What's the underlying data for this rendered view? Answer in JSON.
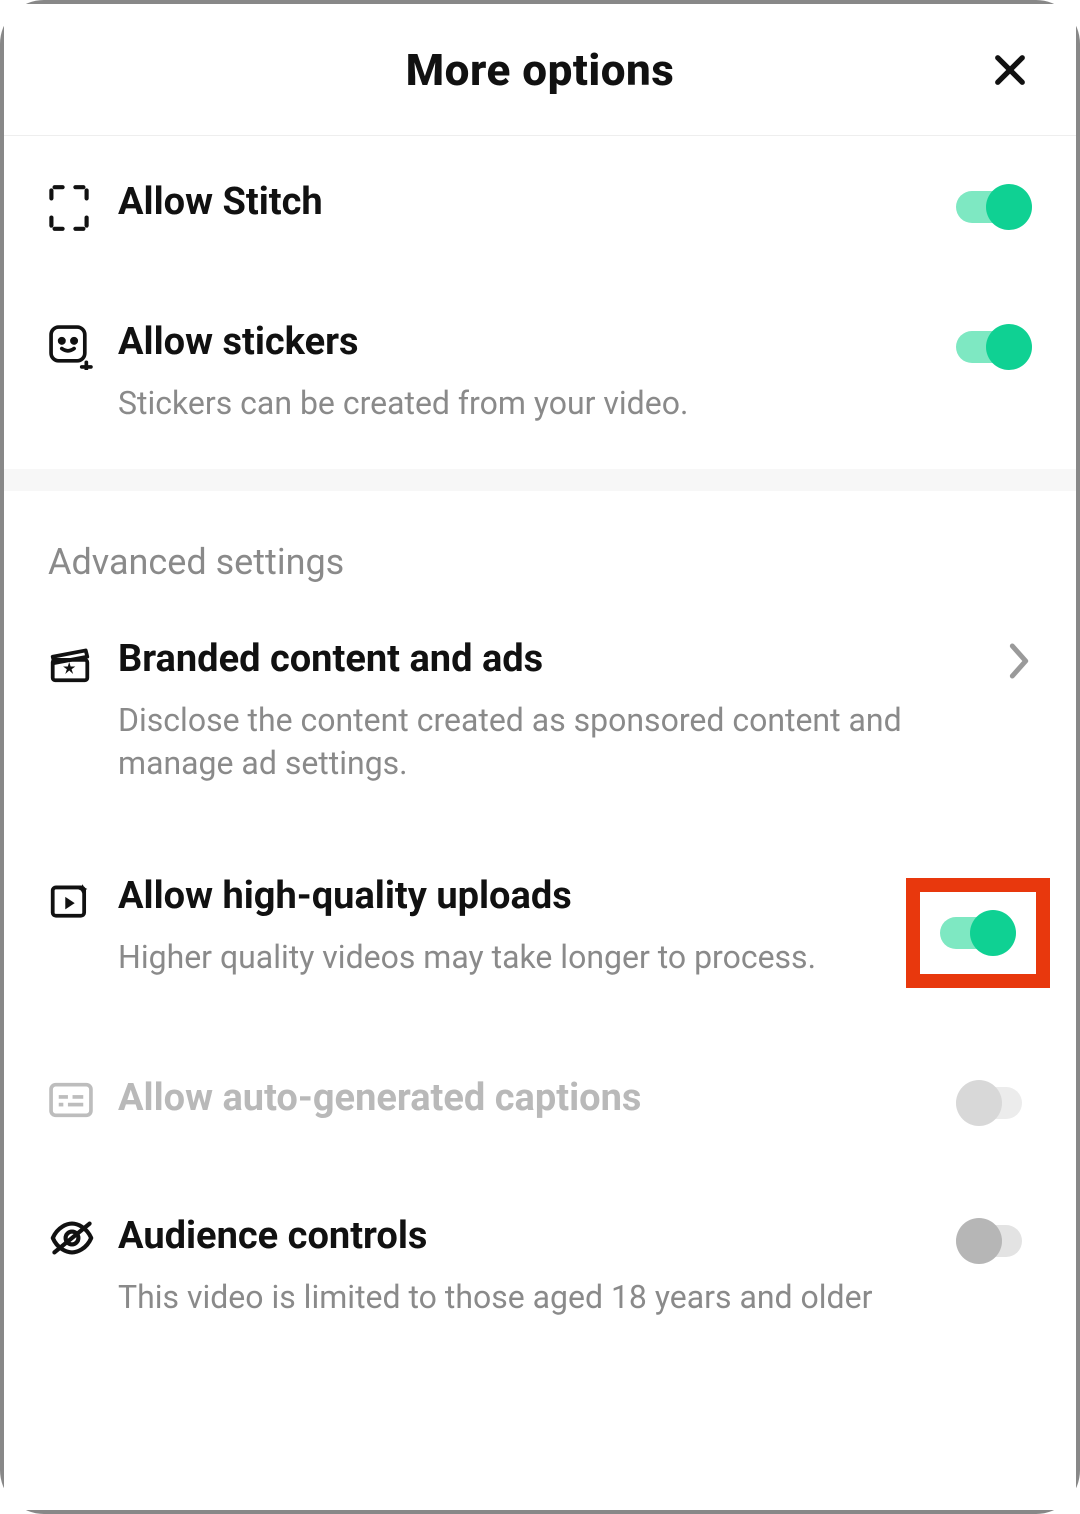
{
  "header": {
    "title": "More options"
  },
  "rows": {
    "stitch": {
      "title": "Allow Stitch"
    },
    "stickers": {
      "title": "Allow stickers",
      "sub": "Stickers can be created from your video."
    },
    "advanced_header": "Advanced settings",
    "branded": {
      "title": "Branded content and ads",
      "sub": "Disclose the content created as sponsored content and manage ad settings."
    },
    "hq": {
      "title": "Allow high-quality uploads",
      "sub": "Higher quality videos may take longer to process."
    },
    "captions": {
      "title": "Allow auto-generated captions"
    },
    "audience": {
      "title": "Audience controls",
      "sub": "This video is limited to those aged 18 years and older"
    }
  },
  "toggles": {
    "stitch": true,
    "stickers": true,
    "hq": true,
    "captions": false,
    "audience": false
  }
}
